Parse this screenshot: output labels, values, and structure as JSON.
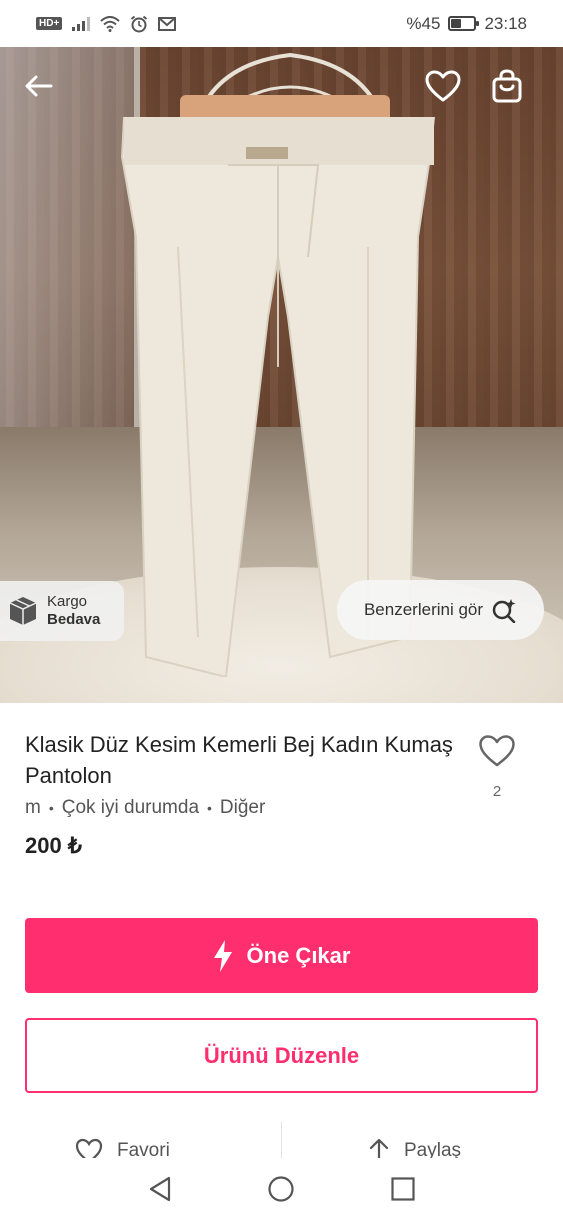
{
  "status_bar": {
    "hd_label": "HD+",
    "battery_text": "%45",
    "battery_level": 0.45,
    "time": "23:18"
  },
  "hero": {
    "image_description_icon": "product-photo",
    "carousel": {
      "total": 3,
      "active": 0
    },
    "cargo_badge": {
      "line1": "Kargo",
      "line2": "Bedava"
    },
    "similar_button_label": "Benzerlerini gör"
  },
  "product": {
    "title": "Klasik Düz Kesim Kemerli Bej Kadın Kumaş Pantolon",
    "favorite_count": "2",
    "size": "m",
    "condition": "Çok iyi durumda",
    "brand": "Diğer",
    "separator": "•",
    "price": "200 ₺"
  },
  "actions": {
    "promote_label": "Öne Çıkar",
    "edit_label": "Ürünü Düzenle",
    "favorite_label": "Favori",
    "share_label": "Paylaş"
  },
  "colors": {
    "accent": "#ff2e6e"
  }
}
